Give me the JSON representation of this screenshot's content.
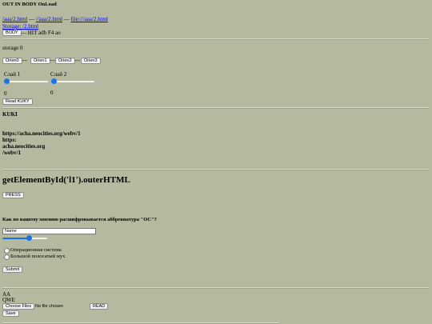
{
  "header": {
    "title": "OUT IN BODY OnLoad",
    "links": [
      "/aaa/2.html",
      "//aaa/2.html",
      "file:///aaa/2.html"
    ],
    "sep1": "—",
    "sep2": "—",
    "storage_link": "Storage: /2.html",
    "body_button": "BODY",
    "hit_text": "— HIT adb F4 ao"
  },
  "storage": {
    "label": "storage 0",
    "orient_buttons": [
      "Orien0",
      "Orien1",
      "Orien2",
      "Orien3"
    ],
    "sep": "—"
  },
  "sliders": [
    {
      "label": "Слай 1",
      "value_text": "0",
      "value": 0
    },
    {
      "label": "Слай 2",
      "value_text": "0",
      "value": 0
    }
  ],
  "kuki": {
    "button": "Read KUKY",
    "heading": "KUKI",
    "lines": [
      "https://acha.neocities.org/webv/1",
      "https:",
      "acha.neocities.org",
      "/webv/1"
    ]
  },
  "outer": {
    "heading": "getElementById('l1').outerHTML",
    "press_button": "PRESS"
  },
  "quiz": {
    "question": "Как по вашему мнению расшифровывается аббревиатура \"ОС\"?",
    "name_value": "Name",
    "range_value": 0.6,
    "options": [
      "Операционная система",
      "Большой полосатый мух"
    ],
    "submit": "Submit"
  },
  "files": {
    "aa": "AA",
    "qwe": "QWE",
    "choose_button": "Choose Files",
    "no_file": "No file chosen",
    "read_button": "READ",
    "save_button": "Save"
  },
  "colors": {
    "background": "#b5b99f",
    "link": "#0000ee",
    "accent": "#1a73e8"
  }
}
